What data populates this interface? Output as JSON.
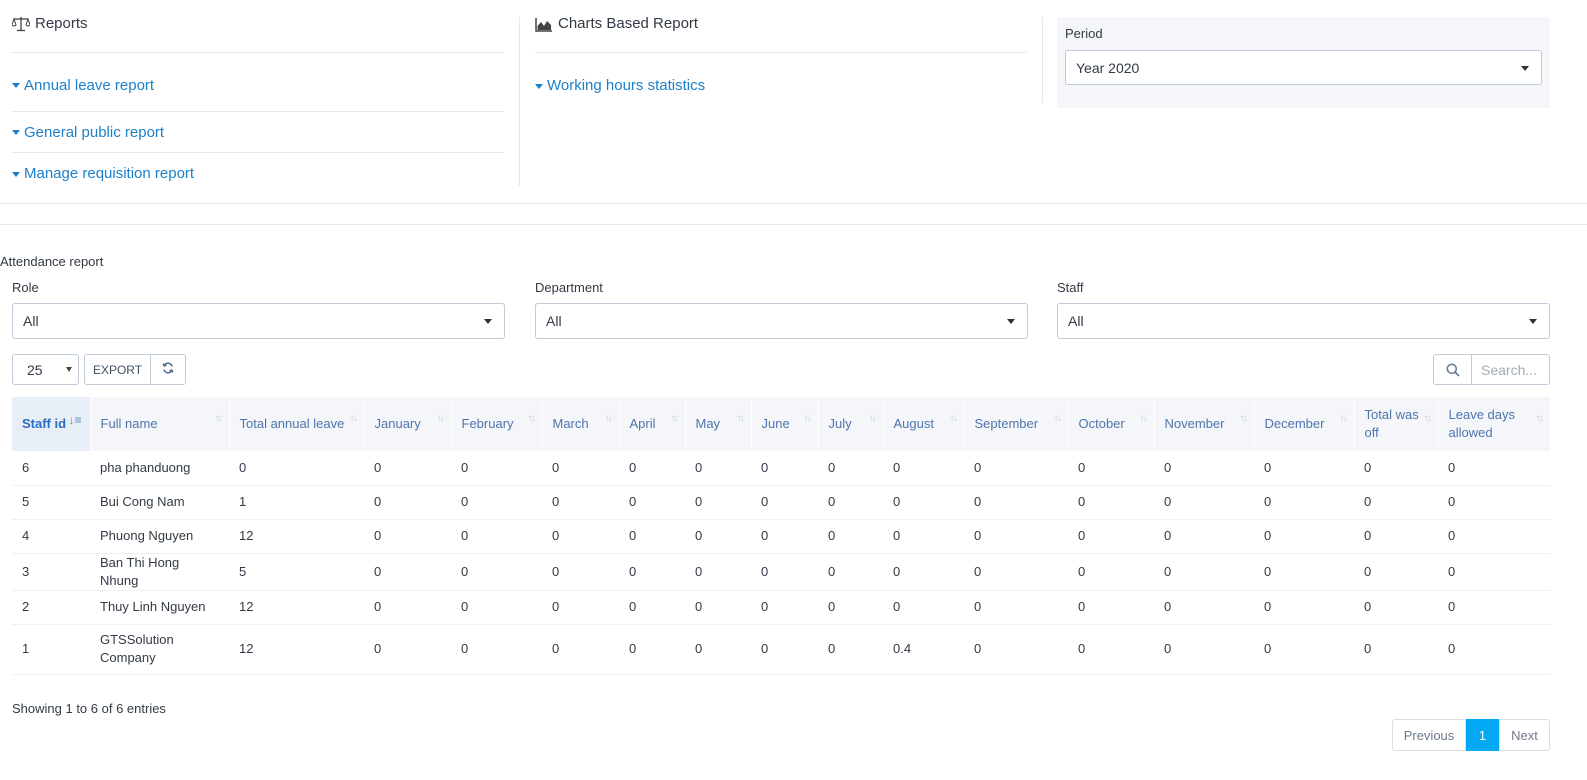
{
  "reports": {
    "title": "Reports",
    "icon": "balance-scale-icon",
    "links": [
      "Annual leave report",
      "General public report",
      "Manage requisition report"
    ]
  },
  "charts": {
    "title": "Charts Based Report",
    "icon": "area-chart-icon",
    "links": [
      "Working hours statistics"
    ]
  },
  "period": {
    "label": "Period",
    "value": "Year 2020"
  },
  "attendance": {
    "title": "Attendance report",
    "filters": {
      "role": {
        "label": "Role",
        "value": "All"
      },
      "department": {
        "label": "Department",
        "value": "All"
      },
      "staff": {
        "label": "Staff",
        "value": "All"
      }
    },
    "page_length": "25",
    "export_label": "EXPORT",
    "search_placeholder": "Search...",
    "columns": [
      "Staff id",
      "Full name",
      "Total annual leave",
      "January",
      "February",
      "March",
      "April",
      "May",
      "June",
      "July",
      "August",
      "September",
      "October",
      "November",
      "December",
      "Total was off",
      "Leave days allowed"
    ],
    "rows": [
      [
        "6",
        "pha phanduong",
        "0",
        "0",
        "0",
        "0",
        "0",
        "0",
        "0",
        "0",
        "0",
        "0",
        "0",
        "0",
        "0",
        "0",
        "0"
      ],
      [
        "5",
        "Bui Cong Nam",
        "1",
        "0",
        "0",
        "0",
        "0",
        "0",
        "0",
        "0",
        "0",
        "0",
        "0",
        "0",
        "0",
        "0",
        "0"
      ],
      [
        "4",
        "Phuong Nguyen",
        "12",
        "0",
        "0",
        "0",
        "0",
        "0",
        "0",
        "0",
        "0",
        "0",
        "0",
        "0",
        "0",
        "0",
        "0"
      ],
      [
        "3",
        "Ban Thi Hong Nhung",
        "5",
        "0",
        "0",
        "0",
        "0",
        "0",
        "0",
        "0",
        "0",
        "0",
        "0",
        "0",
        "0",
        "0",
        "0"
      ],
      [
        "2",
        "Thuy Linh Nguyen",
        "12",
        "0",
        "0",
        "0",
        "0",
        "0",
        "0",
        "0",
        "0",
        "0",
        "0",
        "0",
        "0",
        "0",
        "0"
      ],
      [
        "1",
        "GTSSolution Company",
        "12",
        "0",
        "0",
        "0",
        "0",
        "0",
        "0",
        "0",
        "0.4",
        "0",
        "0",
        "0",
        "0",
        "0",
        "0"
      ]
    ],
    "info": "Showing 1 to 6 of 6 entries",
    "pagination": {
      "previous": "Previous",
      "current": "1",
      "next": "Next"
    }
  },
  "colors": {
    "link": "#1c80c9",
    "header_text": "#4e75ad",
    "active_page": "#03a9f4"
  }
}
